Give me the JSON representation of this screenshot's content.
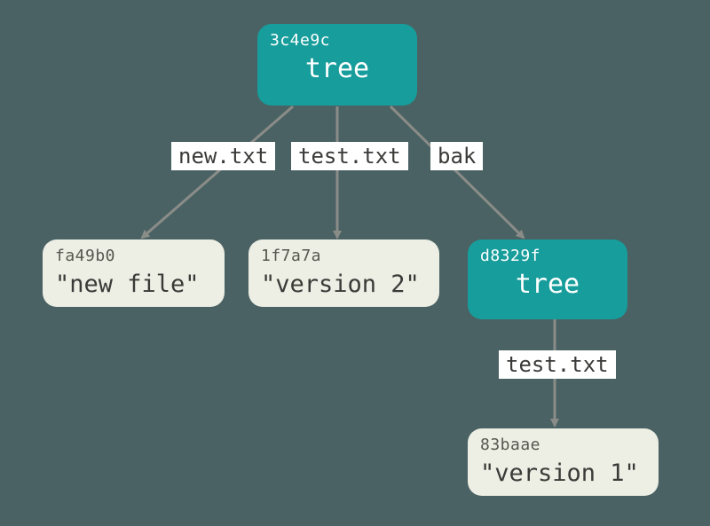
{
  "colors": {
    "background": "#4a6264",
    "tree_fill": "#179d9b",
    "blob_fill": "#edeee4",
    "arrow": "#8a8c87",
    "label_bg": "#ffffff"
  },
  "nodes": {
    "root": {
      "hash": "3c4e9c",
      "kind": "tree"
    },
    "new_file": {
      "hash": "fa49b0",
      "content": "\"new file\""
    },
    "version_2": {
      "hash": "1f7a7a",
      "content": "\"version 2\""
    },
    "bak_tree": {
      "hash": "d8329f",
      "kind": "tree"
    },
    "version_1": {
      "hash": "83baae",
      "content": "\"version 1\""
    }
  },
  "edges": {
    "root_new": {
      "label": "new.txt"
    },
    "root_test": {
      "label": "test.txt"
    },
    "root_bak": {
      "label": "bak"
    },
    "bak_test": {
      "label": "test.txt"
    }
  }
}
